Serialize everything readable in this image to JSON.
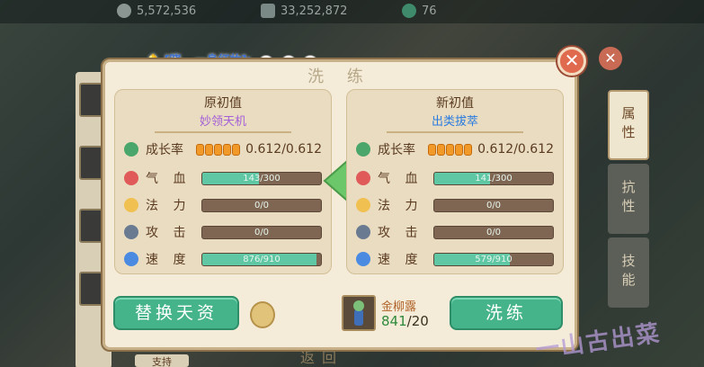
{
  "topbar": {
    "silver": "5,572,536",
    "gold": "33,252,872",
    "jade": "76"
  },
  "chat": {
    "text": "[晓...一身红妆]:"
  },
  "dialog": {
    "title": "洗 练",
    "close_label": "✕",
    "left": {
      "header": "原初值",
      "skill": "妙领天机",
      "skill_color": "#a45ed8",
      "growth_label": "成长率",
      "growth_value": "0.612/0.612",
      "rows": [
        {
          "label": "气 血",
          "text": "143/300",
          "ratio": 0.477
        },
        {
          "label": "法 力",
          "text": "0/0",
          "ratio": 0
        },
        {
          "label": "攻 击",
          "text": "0/0",
          "ratio": 0
        },
        {
          "label": "速 度",
          "text": "876/910",
          "ratio": 0.963
        }
      ]
    },
    "right": {
      "header": "新初值",
      "skill": "出类拔萃",
      "skill_color": "#2a7ce0",
      "growth_label": "成长率",
      "growth_value": "0.612/0.612",
      "rows": [
        {
          "label": "气 血",
          "text": "141/300",
          "ratio": 0.47
        },
        {
          "label": "法 力",
          "text": "0/0",
          "ratio": 0
        },
        {
          "label": "攻 击",
          "text": "0/0",
          "ratio": 0
        },
        {
          "label": "速 度",
          "text": "579/910",
          "ratio": 0.636
        }
      ]
    },
    "replace_button": "替换天资",
    "wash_button": "洗练",
    "item": {
      "name": "金柳露",
      "have": "841",
      "need": "/20"
    }
  },
  "tabs": [
    "属性",
    "抗性",
    "技能"
  ],
  "bottom": {
    "back": "返回",
    "left_label": "支持"
  },
  "watermark": "一山古出菜",
  "colors": {
    "accent": "#46b48a",
    "bar_fill": "#5fc7a3",
    "close": "#e06a4e"
  },
  "icons": [
    "leaf-icon",
    "heart-icon",
    "circle-icon",
    "sword-icon",
    "wing-icon"
  ]
}
